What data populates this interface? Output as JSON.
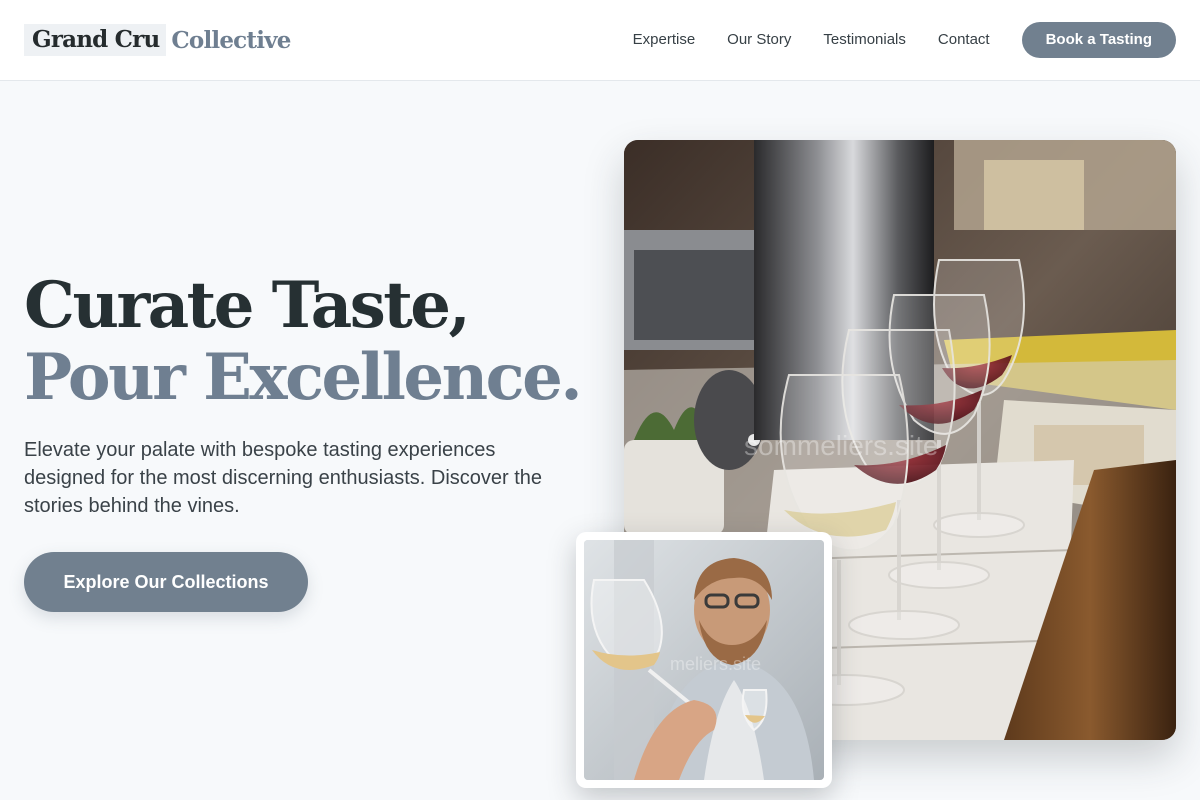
{
  "brand": {
    "name_primary": "Grand Cru",
    "name_secondary": "Collective"
  },
  "nav": {
    "items": [
      {
        "label": "Expertise"
      },
      {
        "label": "Our Story"
      },
      {
        "label": "Testimonials"
      },
      {
        "label": "Contact"
      }
    ],
    "cta_label": "Book a Tasting"
  },
  "hero": {
    "title_line1": "Curate Taste,",
    "title_line2": "Pour Excellence.",
    "subtitle": "Elevate your palate with bespoke tasting experiences designed for the most discerning enthusiasts. Discover the stories behind the vines.",
    "cta_label": "Explore Our Collections"
  },
  "images": {
    "main_watermark": "sommeliers.site",
    "small_watermark": "meliers.site"
  },
  "colors": {
    "accent": "#71808f",
    "heading_dark": "#263033",
    "background": "#f7f9fb"
  }
}
